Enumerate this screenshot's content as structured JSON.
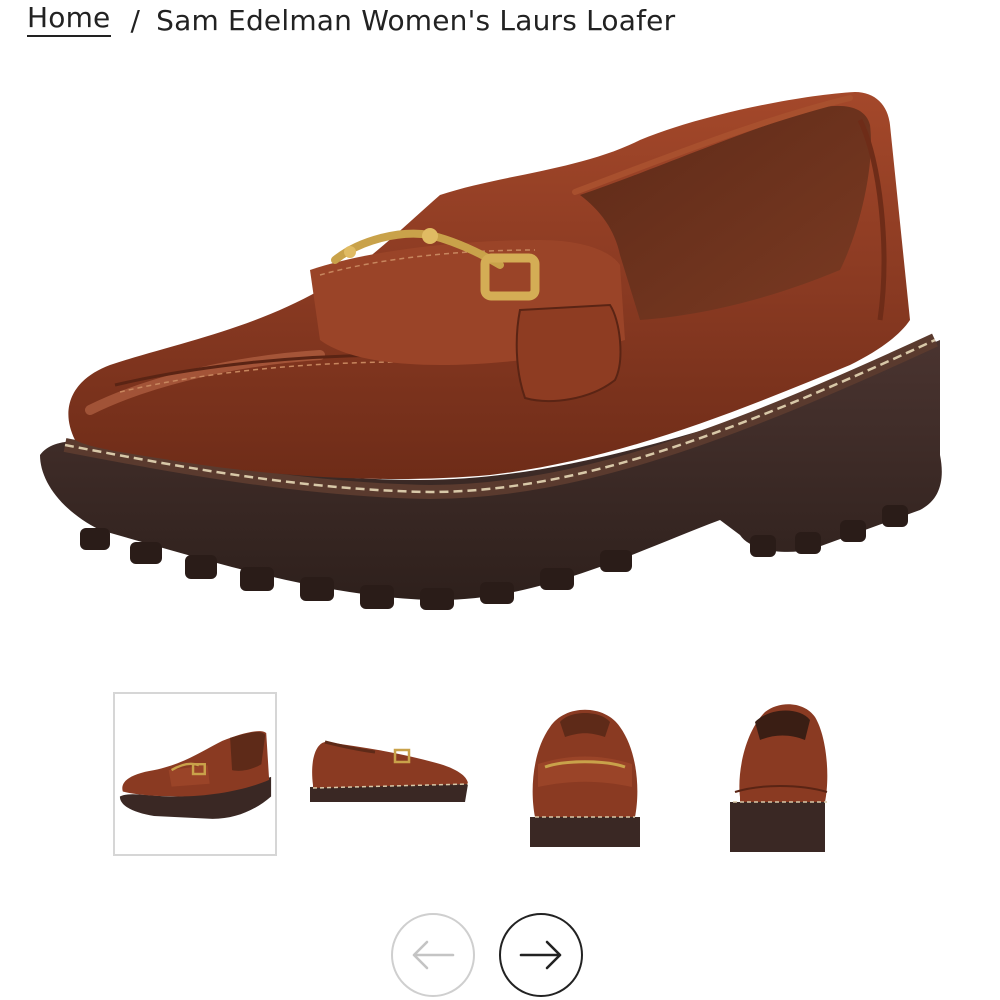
{
  "breadcrumb": {
    "home_label": "Home",
    "separator": "/",
    "current": "Sam Edelman Women's Laurs Loafer"
  },
  "gallery": {
    "main_image_alt": "Sam Edelman Women's Laurs Loafer",
    "selected_thumbnail": 1,
    "thumbnails": [
      {
        "view": "three-quarter"
      },
      {
        "view": "side"
      },
      {
        "view": "front"
      },
      {
        "view": "back"
      }
    ],
    "prev_icon": "arrow-left-icon",
    "next_icon": "arrow-right-icon"
  },
  "colors": {
    "leather": "#8a3a22",
    "leather_highlight": "#b8644a",
    "sole": "#3a2824",
    "buckle": "#c9a24a",
    "stitch": "#d8c8a8",
    "text": "#222222",
    "thumb_border": "#d6d6d6",
    "prev_border": "#cfcfcf"
  }
}
